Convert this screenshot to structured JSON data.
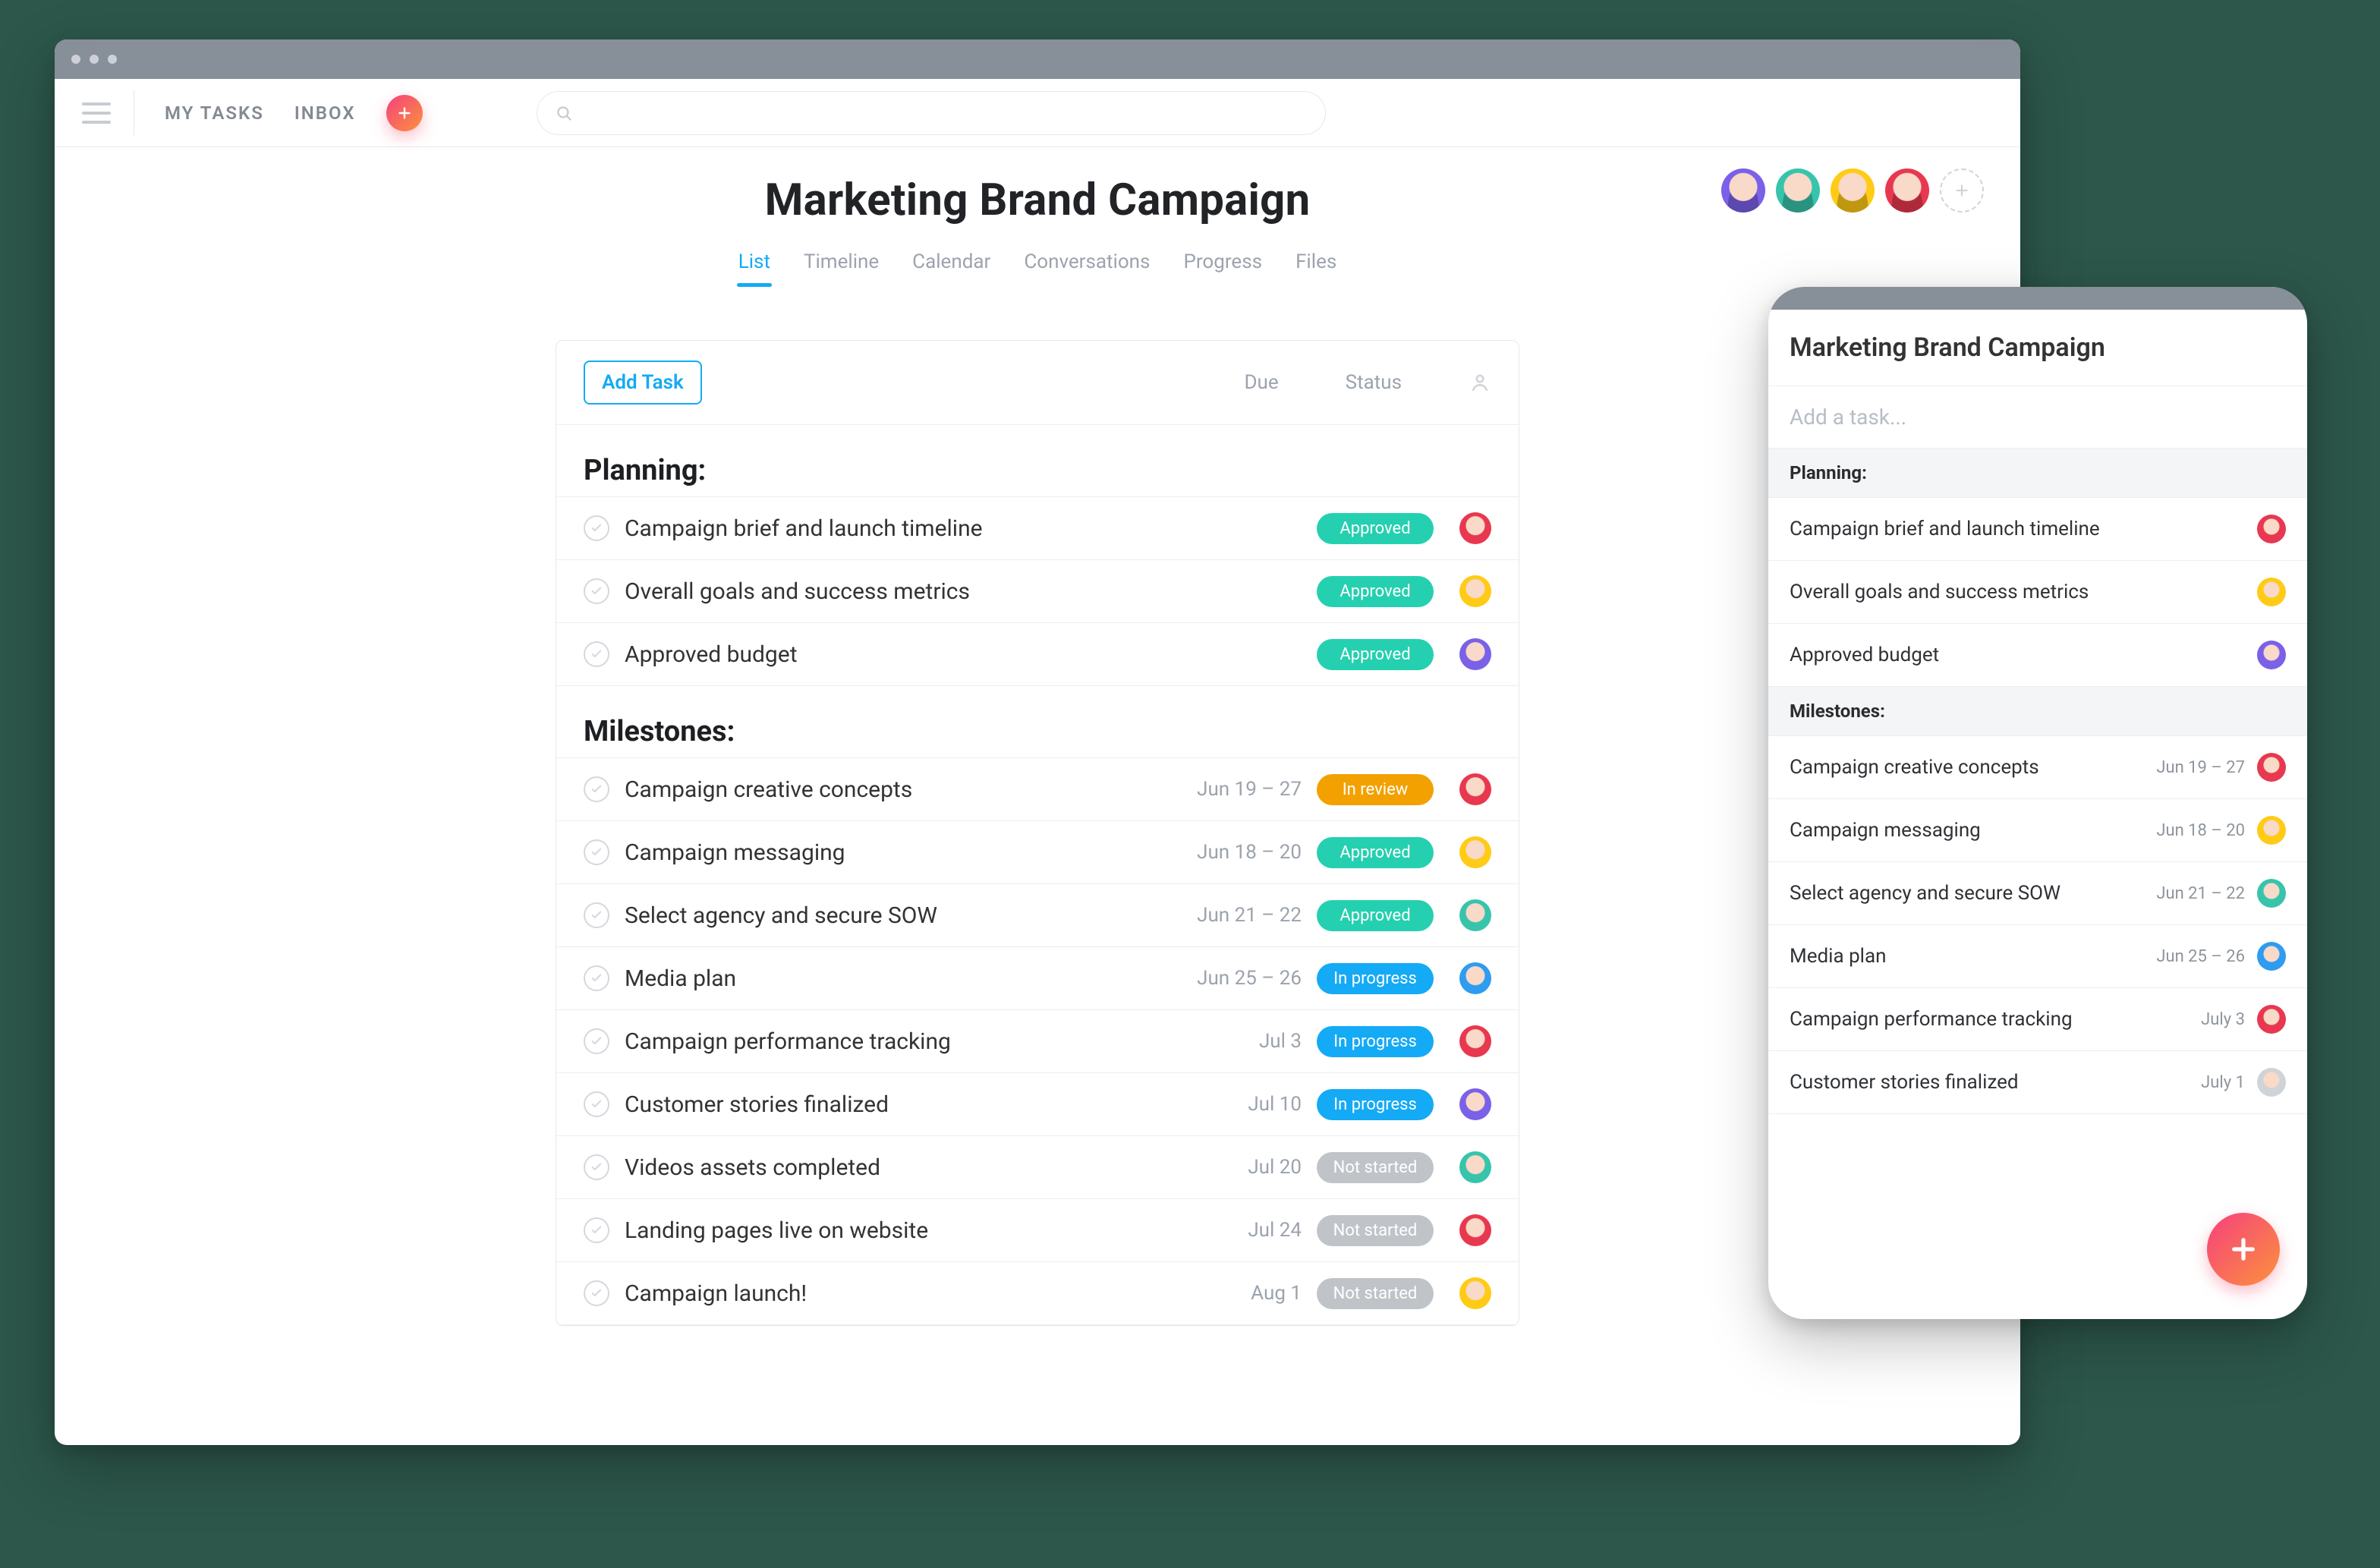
{
  "nav": {
    "my_tasks": "MY TASKS",
    "inbox": "INBOX",
    "search_placeholder": ""
  },
  "project": {
    "title": "Marketing Brand Campaign",
    "tabs": [
      "List",
      "Timeline",
      "Calendar",
      "Conversations",
      "Progress",
      "Files"
    ],
    "active_tab": 0,
    "members": [
      "purple",
      "green",
      "yellow",
      "red"
    ]
  },
  "card": {
    "add_task": "Add Task",
    "cols": {
      "due": "Due",
      "status": "Status"
    }
  },
  "status_colors": {
    "Approved": "#25d0b0",
    "In review": "#f2a100",
    "In progress": "#14aaf5",
    "Not started": "#c0c4c9"
  },
  "avatar_colors": {
    "red": "#e8384f",
    "yellow": "#ffcb16",
    "green": "#37c4ab",
    "purple": "#7b60e8",
    "blue": "#2E9CF0",
    "teal": "#25d0b0"
  },
  "sections": [
    {
      "title": "Planning:",
      "tasks": [
        {
          "name": "Campaign brief and launch timeline",
          "due": "",
          "status": "Approved",
          "assignee": "red"
        },
        {
          "name": "Overall goals and success metrics",
          "due": "",
          "status": "Approved",
          "assignee": "yellow"
        },
        {
          "name": "Approved budget",
          "due": "",
          "status": "Approved",
          "assignee": "purple"
        }
      ]
    },
    {
      "title": "Milestones:",
      "tasks": [
        {
          "name": "Campaign creative concepts",
          "due": "Jun 19 – 27",
          "status": "In review",
          "assignee": "red"
        },
        {
          "name": "Campaign messaging",
          "due": "Jun 18 – 20",
          "status": "Approved",
          "assignee": "yellow"
        },
        {
          "name": "Select agency and secure SOW",
          "due": "Jun 21 – 22",
          "status": "Approved",
          "assignee": "green"
        },
        {
          "name": "Media plan",
          "due": "Jun 25 – 26",
          "status": "In progress",
          "assignee": "blue"
        },
        {
          "name": "Campaign performance tracking",
          "due": "Jul 3",
          "status": "In progress",
          "assignee": "red"
        },
        {
          "name": "Customer stories finalized",
          "due": "Jul 10",
          "status": "In progress",
          "assignee": "purple"
        },
        {
          "name": "Videos assets completed",
          "due": "Jul 20",
          "status": "Not started",
          "assignee": "green"
        },
        {
          "name": "Landing pages live on website",
          "due": "Jul 24",
          "status": "Not started",
          "assignee": "red"
        },
        {
          "name": "Campaign launch!",
          "due": "Aug 1",
          "status": "Not started",
          "assignee": "yellow"
        }
      ]
    }
  ],
  "mobile": {
    "title": "Marketing Brand Campaign",
    "add_placeholder": "Add a task...",
    "sections": [
      {
        "title": "Planning:",
        "tasks": [
          {
            "name": "Campaign brief and launch timeline",
            "due": "",
            "assignee": "red"
          },
          {
            "name": "Overall goals and success metrics",
            "due": "",
            "assignee": "yellow"
          },
          {
            "name": "Approved budget",
            "due": "",
            "assignee": "purple"
          }
        ]
      },
      {
        "title": "Milestones:",
        "tasks": [
          {
            "name": "Campaign creative concepts",
            "due": "Jun 19 – 27",
            "assignee": "red"
          },
          {
            "name": "Campaign messaging",
            "due": "Jun 18 – 20",
            "assignee": "yellow"
          },
          {
            "name": "Select agency and secure SOW",
            "due": "Jun 21 – 22",
            "assignee": "green"
          },
          {
            "name": "Media plan",
            "due": "Jun 25 – 26",
            "assignee": "blue"
          },
          {
            "name": "Campaign performance tracking",
            "due": "July 3",
            "assignee": "red"
          },
          {
            "name": "Customer stories finalized",
            "due": "July 1",
            "assignee": ""
          }
        ]
      }
    ]
  }
}
